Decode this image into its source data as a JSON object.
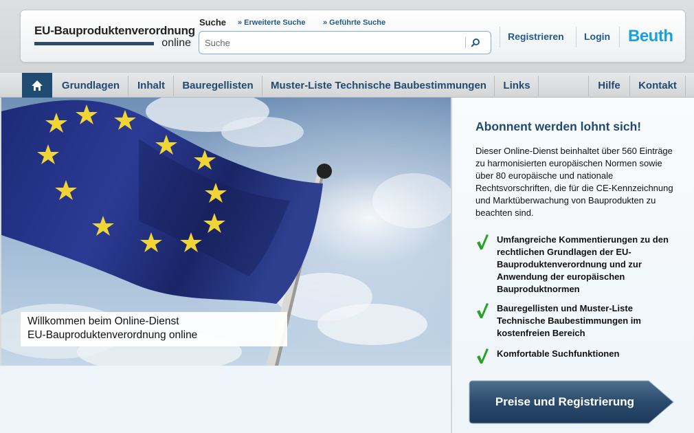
{
  "header": {
    "logo_line1": "EU-Bauproduktenverordnung",
    "logo_line2": "online",
    "search_label": "Suche",
    "advanced_search": "» Erweiterte Suche",
    "guided_search": "» Geführte Suche",
    "search_placeholder": "Suche",
    "register": "Registrieren",
    "login": "Login",
    "brand": "Beuth"
  },
  "nav": {
    "home_icon": "home-icon",
    "items": [
      "Grundlagen",
      "Inhalt",
      "Bauregellisten",
      "Muster-Liste Technische Baubestimmungen",
      "Links"
    ],
    "right_items": [
      "Hilfe",
      "Kontakt"
    ]
  },
  "hero": {
    "caption_line1": "Willkommen beim Online-Dienst",
    "caption_line2": "EU-Bauproduktenverordnung online"
  },
  "panel": {
    "title": "Abonnent werden lohnt sich!",
    "intro": "Dieser Online-Dienst beinhaltet über 560 Einträge zu harmonisierten europäischen Normen sowie über 80 europäische und nationale Rechtsvorschriften, die für die CE-Kennzeichnung und Marktüberwachung von Bauprodukten zu beachten sind.",
    "features": [
      "Umfangreiche Kommentierungen zu den rechtlichen Grundlagen der EU-Bauproduktenverordnung und zur Anwendung der europäischen Bauproduktnormen",
      "Bauregellisten und Muster-Liste Technische Baubestimmungen im kostenfreien Bereich",
      "Komfortable Suchfunktionen"
    ],
    "cta": "Preise und Registrierung"
  },
  "colors": {
    "navy": "#1f4b72",
    "link_blue": "#1f5a8a",
    "brand_blue": "#1aa0de",
    "check_green": "#2aa12a"
  }
}
